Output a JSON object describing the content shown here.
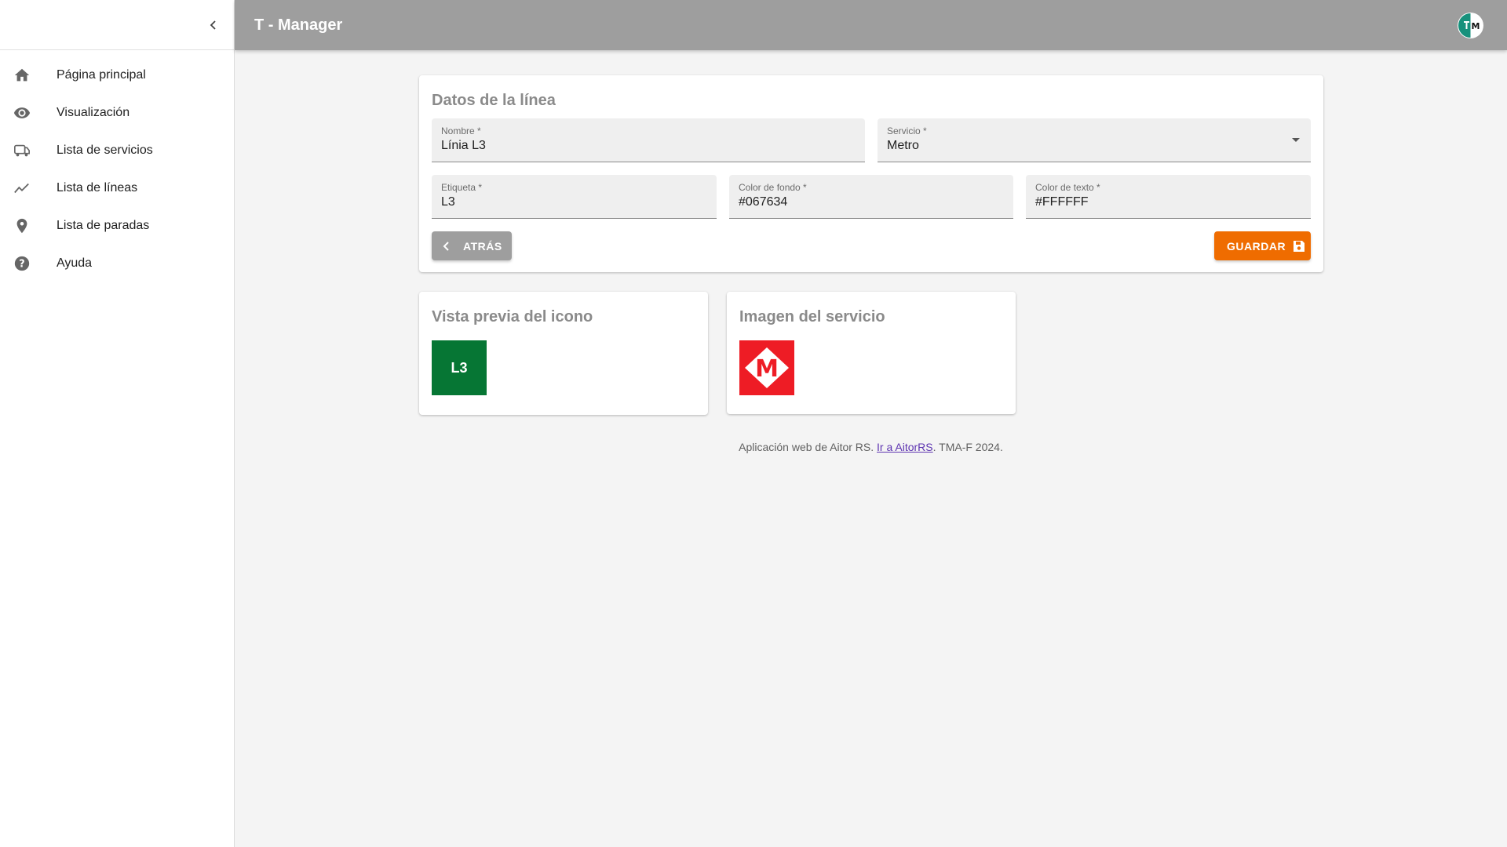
{
  "app": {
    "title": "T - Manager",
    "logo_letters": "M"
  },
  "sidebar": {
    "items": [
      {
        "label": "Página principal",
        "icon": "home-icon"
      },
      {
        "label": "Visualización",
        "icon": "eye-icon"
      },
      {
        "label": "Lista de servicios",
        "icon": "bus-icon"
      },
      {
        "label": "Lista de líneas",
        "icon": "trending-line-icon"
      },
      {
        "label": "Lista de paradas",
        "icon": "map-pin-icon"
      },
      {
        "label": "Ayuda",
        "icon": "help-circle-icon"
      }
    ]
  },
  "form": {
    "title": "Datos de la línea",
    "nombre": {
      "label": "Nombre *",
      "value": "Línia L3"
    },
    "servicio": {
      "label": "Servicio *",
      "value": "Metro"
    },
    "etiqueta": {
      "label": "Etiqueta *",
      "value": "L3"
    },
    "color_fondo": {
      "label": "Color de fondo *",
      "value": "#067634"
    },
    "color_texto": {
      "label": "Color de texto *",
      "value": "#FFFFFF"
    },
    "back_label": "ATRÁS",
    "save_label": "GUARDAR"
  },
  "preview": {
    "title": "Vista previa del icono",
    "icon_text": "L3",
    "bg_color": "#067634",
    "text_color": "#FFFFFF"
  },
  "service_image": {
    "title": "Imagen del servicio",
    "logo_letter": "M",
    "color": "#EE1C25"
  },
  "footer": {
    "prefix": "Aplicación web de Aitor RS.",
    "link": "Ir a AitorRS",
    "suffix": ". TMA-F 2024."
  },
  "colors": {
    "header": "#9E9E9E",
    "accent": "#EF6C00"
  }
}
